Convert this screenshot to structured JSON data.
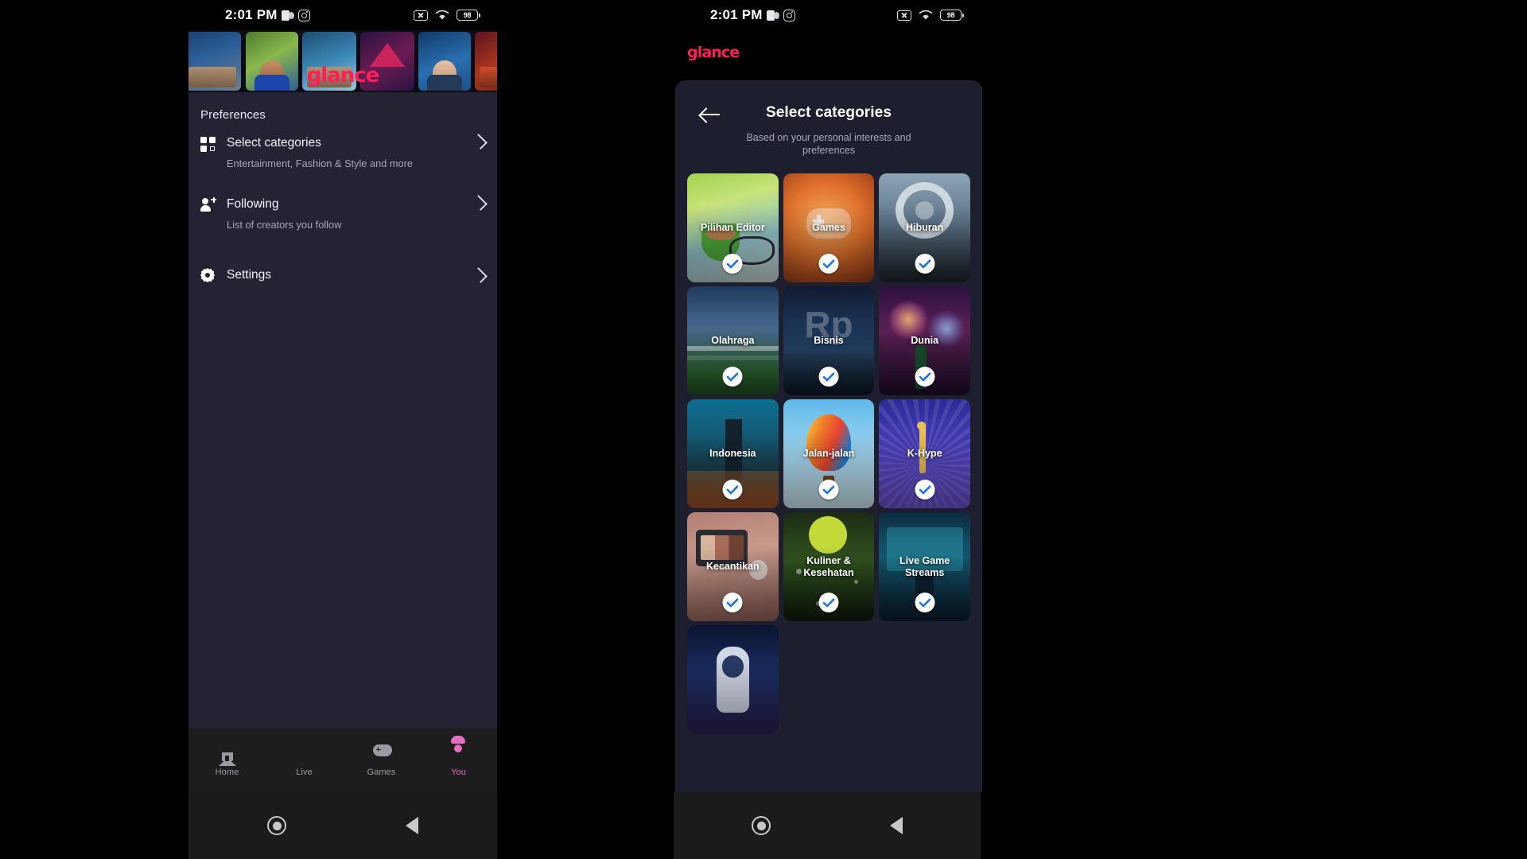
{
  "status_bar": {
    "time": "2:01 PM",
    "left_icons": [
      "teams-icon",
      "instagram-icon"
    ],
    "right_icons": [
      "sim-off-icon",
      "wifi-icon",
      "battery-icon"
    ],
    "battery_level": "98"
  },
  "left_phone": {
    "brand_logo": "glance",
    "preferences": {
      "section_title": "Preferences",
      "items": [
        {
          "icon": "grid-icon",
          "label": "Select categories",
          "subtitle": "Entertainment, Fashion & Style and more",
          "chevron": "chevron-right-icon"
        },
        {
          "icon": "person-add-icon",
          "label": "Following",
          "subtitle": "List of creators you follow",
          "chevron": "chevron-right-icon"
        },
        {
          "icon": "gear-icon",
          "label": "Settings",
          "subtitle": "",
          "chevron": "chevron-right-icon"
        }
      ]
    },
    "tab_bar": {
      "active": "You",
      "active_color": "#e46ec0",
      "inactive_color": "#9b9ba3",
      "tabs": [
        {
          "label": "Home",
          "icon": "home-icon"
        },
        {
          "label": "Live",
          "icon": "play-icon"
        },
        {
          "label": "Games",
          "icon": "gamepad-icon"
        },
        {
          "label": "You",
          "icon": "person-icon"
        }
      ]
    }
  },
  "right_phone": {
    "brand_logo": "glance",
    "brand_color": "#ff1e56",
    "sheet": {
      "back_icon": "arrow-left-icon",
      "title": "Select categories",
      "subtitle": "Based on your personal interests and preferences",
      "check_icon": "check-icon",
      "check_color": "#1a73e8",
      "categories": [
        {
          "label": "Pilihan Editor",
          "selected": true,
          "art": "a-editor"
        },
        {
          "label": "Games",
          "selected": true,
          "art": "a-games"
        },
        {
          "label": "Hiburan",
          "selected": true,
          "art": "a-hiburan"
        },
        {
          "label": "Olahraga",
          "selected": true,
          "art": "a-olahraga"
        },
        {
          "label": "Bisnis",
          "selected": true,
          "art": "a-bisnis"
        },
        {
          "label": "Dunia",
          "selected": true,
          "art": "a-dunia"
        },
        {
          "label": "Indonesia",
          "selected": true,
          "art": "a-indonesia"
        },
        {
          "label": "Jalan-jalan",
          "selected": true,
          "art": "a-jalan"
        },
        {
          "label": "K-Hype",
          "selected": true,
          "art": "a-khype"
        },
        {
          "label": "Kecantikan",
          "selected": true,
          "art": "a-kecantikan"
        },
        {
          "label": "Kuliner & Kesehatan",
          "selected": true,
          "art": "a-kuliner"
        },
        {
          "label": "Live Game Streams",
          "selected": true,
          "art": "a-livegame"
        },
        {
          "label": "",
          "selected": false,
          "art": "a-astro"
        }
      ]
    }
  },
  "android_nav": {
    "home_icon": "home-circle-icon",
    "back_icon": "back-triangle-icon"
  }
}
